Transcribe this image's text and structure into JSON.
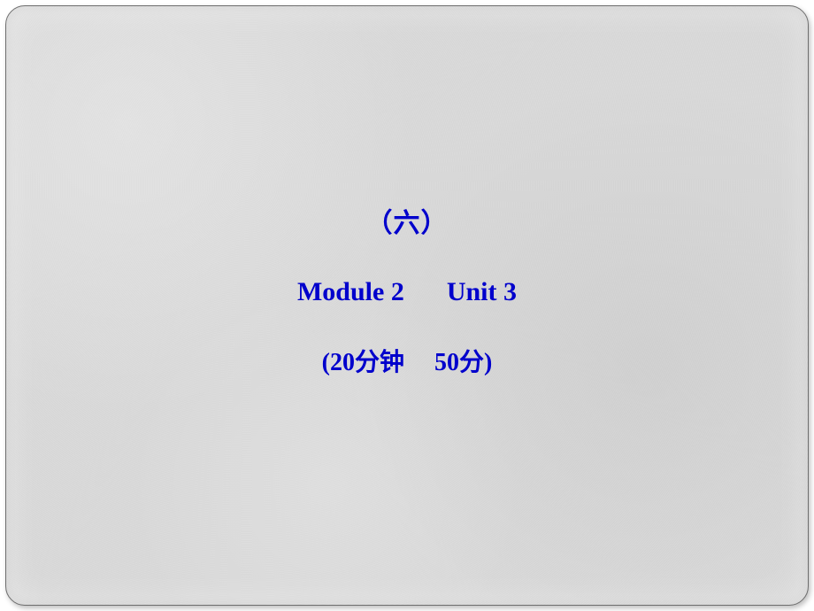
{
  "title": {
    "label_cn": "（六）"
  },
  "subtitle": {
    "module": "Module 2",
    "unit": "Unit 3"
  },
  "meta": {
    "open_paren": "(",
    "time_num": "20",
    "time_unit": "分钟",
    "score_num": "50",
    "score_unit": "分",
    "close_paren": ")"
  }
}
